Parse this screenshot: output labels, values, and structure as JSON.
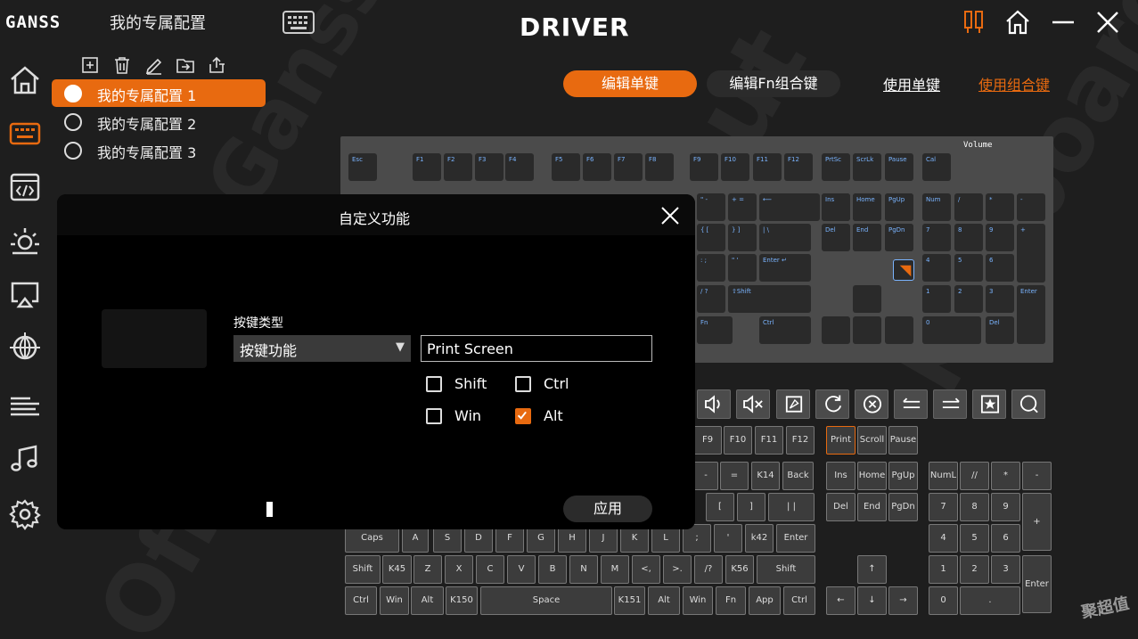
{
  "header": {
    "logo": "GANSS",
    "profile_title": "我的专属配置",
    "driver": "DRIVER"
  },
  "profiles": [
    {
      "label": "我的专属配置 1",
      "active": true
    },
    {
      "label": "我的专属配置 2",
      "active": false
    },
    {
      "label": "我的专属配置 3",
      "active": false
    }
  ],
  "tabs": {
    "edit_single": "编辑单键",
    "edit_fn": "编辑Fn组合键",
    "use_single": "使用单键",
    "use_combo": "使用组合键"
  },
  "keyboard_preview": {
    "volume_label": "Volume",
    "f_row": [
      "Esc",
      "F1",
      "F2",
      "F3",
      "F4",
      "F5",
      "F6",
      "F7",
      "F8",
      "F9",
      "F10",
      "F11",
      "F12",
      "PrtSc",
      "ScrLk",
      "Pause",
      "Cal"
    ],
    "nav_row1": [
      "Ins",
      "Home",
      "PgUp",
      "Num",
      "/",
      "*",
      "-"
    ],
    "nav_row2": [
      "Del",
      "End",
      "PgDn",
      "7",
      "8",
      "9",
      "+"
    ],
    "nav_row3": [
      "4",
      "5",
      "6"
    ],
    "nav_row4": [
      "1",
      "2",
      "3",
      "Enter"
    ],
    "nav_row5": [
      "0",
      "Del"
    ],
    "misc": [
      "{ [",
      "} ]",
      "| \\",
      ": ;",
      "\" '",
      "Enter ↵",
      "/ ?",
      "⇧Shift",
      "Fn",
      "Ctrl",
      "Home",
      "PgUp",
      "PgDn",
      "End",
      "Ins",
      "\" -",
      "+ =",
      "⟵"
    ]
  },
  "media_icons": [
    "volume-up-icon",
    "mute-icon",
    "browser-icon",
    "refresh-icon",
    "stop-icon",
    "back-icon",
    "forward-icon",
    "favorite-icon",
    "search-icon"
  ],
  "layout_keys": {
    "row_f": [
      "F9",
      "F10",
      "F11",
      "F12",
      "Print",
      "Scroll",
      "Pause"
    ],
    "row_num": [
      "-",
      "=",
      "K14",
      "Back",
      "Ins",
      "Home",
      "PgUp",
      "NumL",
      "//",
      "*",
      "-"
    ],
    "row_q": [
      "[",
      "]",
      "| |",
      "Del",
      "End",
      "PgDn",
      "7",
      "8",
      "9",
      "+"
    ],
    "row_a": [
      "Caps",
      "A",
      "S",
      "D",
      "F",
      "G",
      "H",
      "J",
      "K",
      "L",
      ";",
      "'",
      "k42",
      "Enter",
      "4",
      "5",
      "6"
    ],
    "row_z": [
      "Shift",
      "K45",
      "Z",
      "X",
      "C",
      "V",
      "B",
      "N",
      "M",
      "<,",
      ">.",
      "/?",
      "K56",
      "Shift",
      "↑",
      "1",
      "2",
      "3",
      "Enter"
    ],
    "row_ctrl": [
      "Ctrl",
      "Win",
      "Alt",
      "K150",
      "Space",
      "K151",
      "Alt",
      "Win",
      "Fn",
      "App",
      "Ctrl",
      "←",
      "↓",
      "→",
      "0",
      "."
    ]
  },
  "dialog": {
    "title": "自定义功能",
    "key_type_label": "按键类型",
    "key_type_value": "按键功能",
    "function_value": "Print Screen",
    "modifiers": [
      {
        "label": "Shift",
        "checked": false
      },
      {
        "label": "Ctrl",
        "checked": false
      },
      {
        "label": "Win",
        "checked": false
      },
      {
        "label": "Alt",
        "checked": true
      }
    ],
    "apply": "应用"
  },
  "watermark": "聚超值",
  "colors": {
    "accent": "#e86a10",
    "background": "#1e1e1e",
    "dialog": "#000000"
  }
}
